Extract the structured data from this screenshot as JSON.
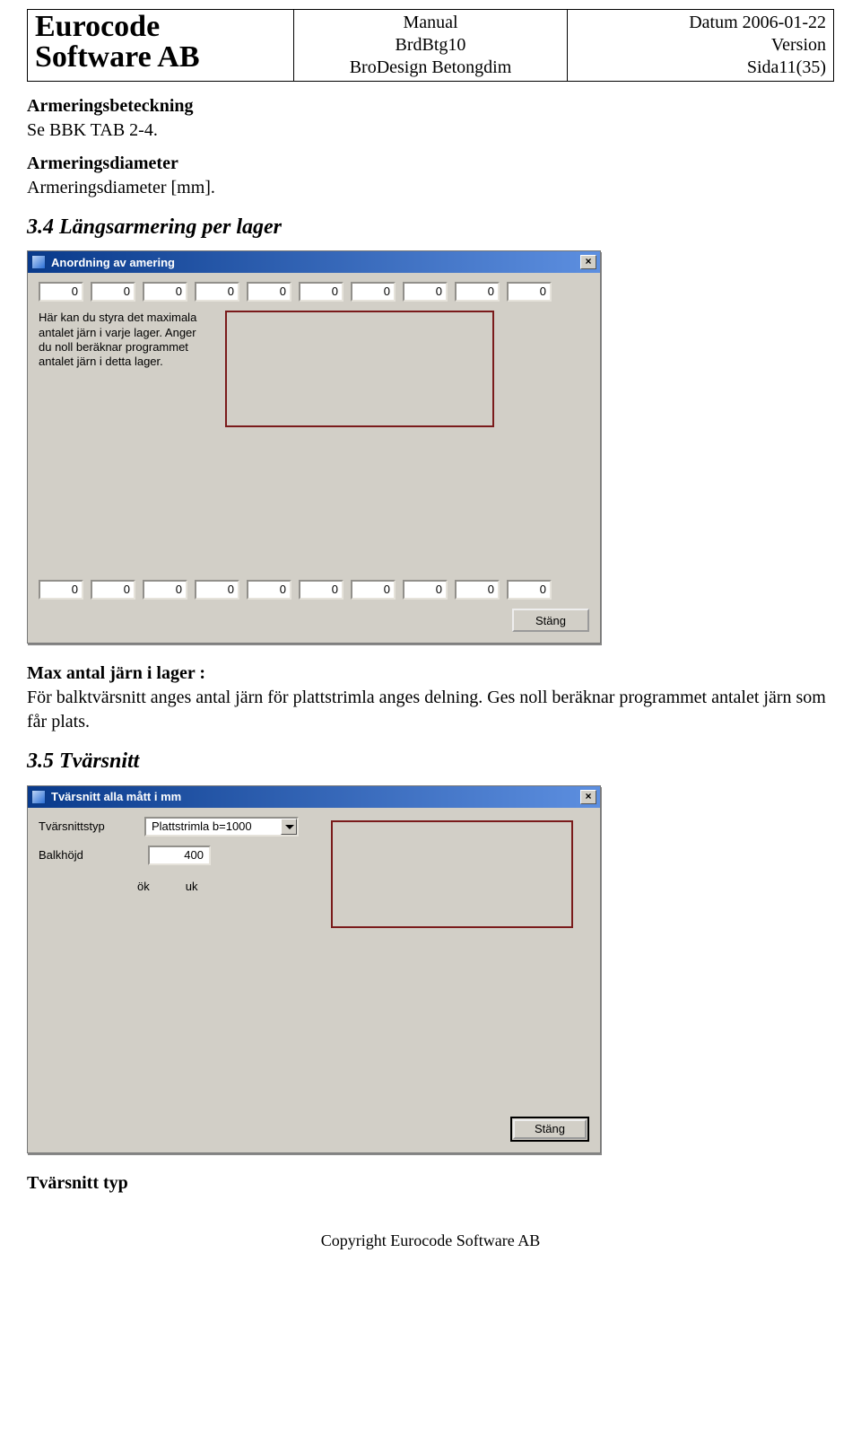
{
  "header": {
    "company_line1": "Eurocode",
    "company_line2": "Software AB",
    "manual_line1": "Manual",
    "manual_line2": "BrdBtg10",
    "manual_line3": "BroDesign Betongdim",
    "date_line": "Datum 2006-01-22",
    "version_line": "Version",
    "page_line": "Sida11(35)"
  },
  "body": {
    "armering_bet_h": "Armeringsbeteckning",
    "armering_bet_t": "Se BBK TAB 2-4.",
    "armering_dia_h": "Armeringsdiameter",
    "armering_dia_t": "Armeringsdiameter [mm].",
    "sec34": "3.4  Längsarmering per lager",
    "max_h": "Max antal järn i lager :",
    "max_t": "För balktvärsnitt anges antal järn för plattstrimla anges delning. Ges noll beräknar programmet antalet järn som får plats.",
    "sec35": "3.5  Tvärsnitt",
    "tvars_typ_h": "Tvärsnitt typ"
  },
  "dlg1": {
    "title": "Anordning av amering",
    "close_x": "×",
    "top_values": [
      "0",
      "0",
      "0",
      "0",
      "0",
      "0",
      "0",
      "0",
      "0",
      "0"
    ],
    "bottom_values": [
      "0",
      "0",
      "0",
      "0",
      "0",
      "0",
      "0",
      "0",
      "0",
      "0"
    ],
    "help_text": "Här kan du styra det maximala antalet järn i varje lager. Anger du noll beräknar programmet antalet järn i detta lager.",
    "btn_close": "Stäng"
  },
  "dlg2": {
    "title": "Tvärsnitt alla mått i mm",
    "close_x": "×",
    "lbl_type": "Tvärsnittstyp",
    "combo_value": "Plattstrimla b=1000",
    "lbl_height": "Balkhöjd",
    "height_value": "400",
    "ok": "ök",
    "uk": "uk",
    "btn_close": "Stäng"
  },
  "footer": "Copyright Eurocode Software AB"
}
